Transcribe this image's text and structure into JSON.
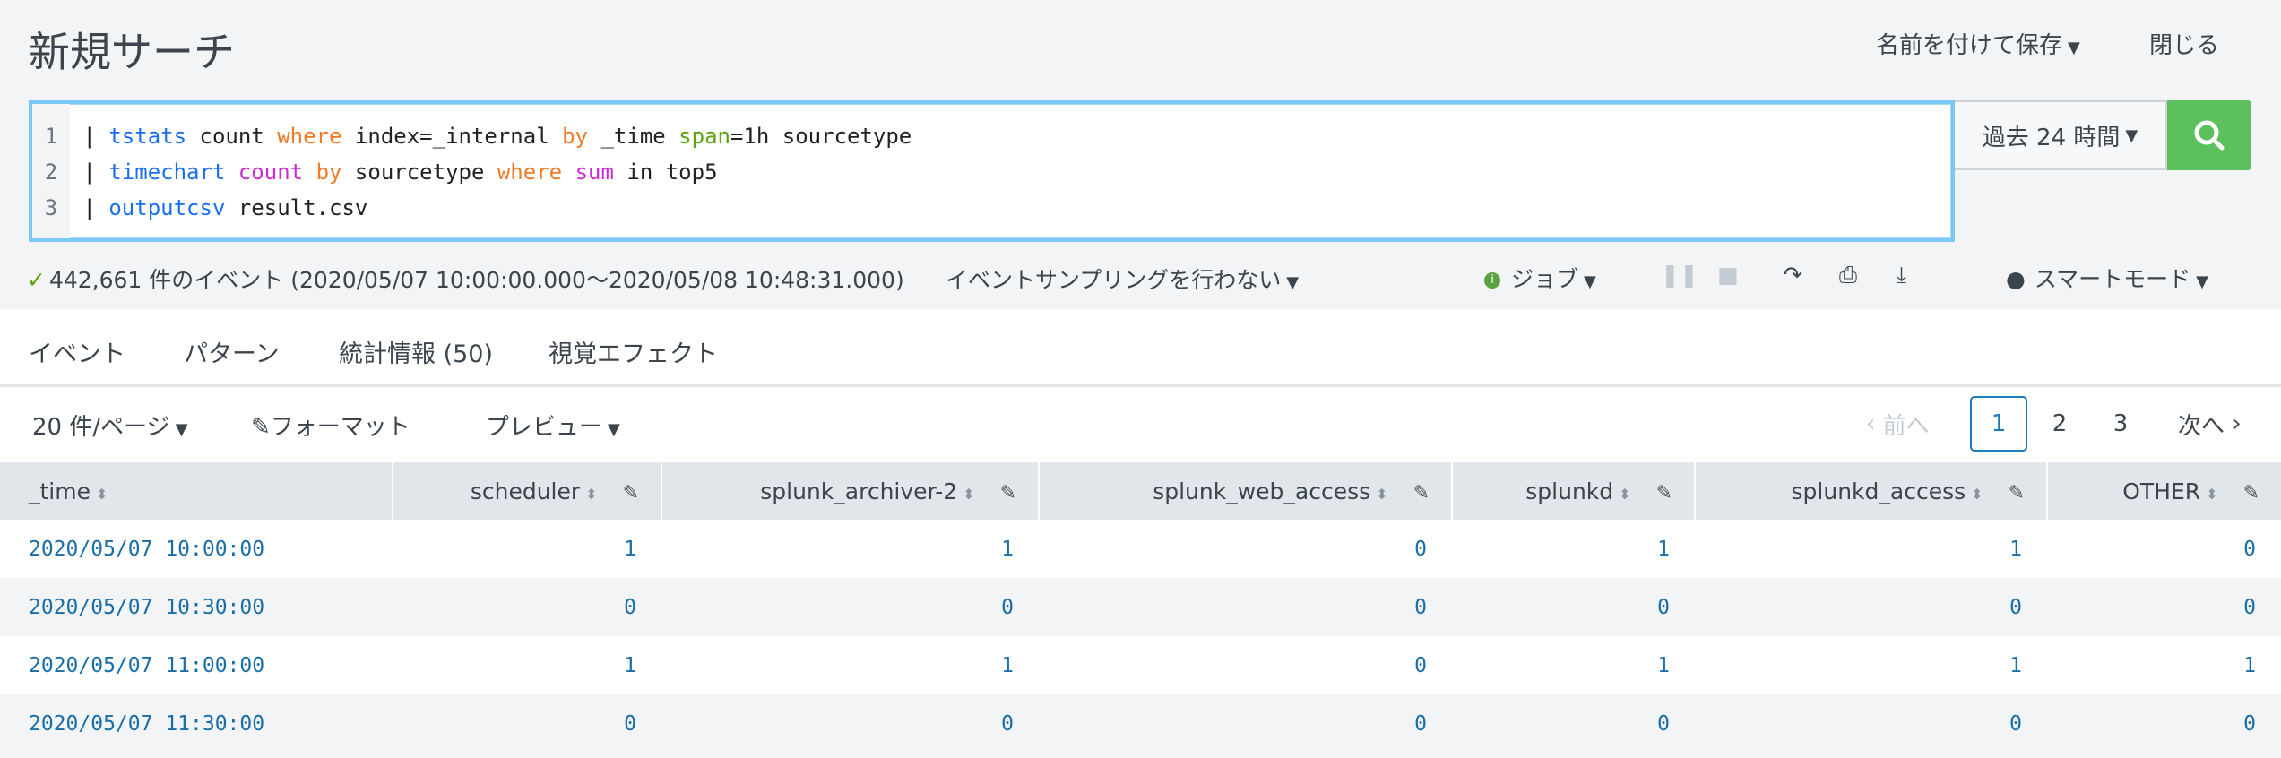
{
  "header": {
    "title": "新規サーチ",
    "save_as": "名前を付けて保存",
    "close": "閉じる"
  },
  "search": {
    "lines": [
      {
        "n": "1",
        "tokens": [
          [
            "| ",
            ""
          ],
          [
            "tstats",
            "kw"
          ],
          [
            " count ",
            ""
          ],
          [
            "where",
            "or"
          ],
          [
            " index=_internal ",
            ""
          ],
          [
            "by",
            "or"
          ],
          [
            " _time ",
            ""
          ],
          [
            "span",
            "gr"
          ],
          [
            "=1h sourcetype",
            ""
          ]
        ]
      },
      {
        "n": "2",
        "tokens": [
          [
            "| ",
            ""
          ],
          [
            "timechart",
            "kw"
          ],
          [
            " ",
            ""
          ],
          [
            "count",
            "mg"
          ],
          [
            " ",
            ""
          ],
          [
            "by",
            "or"
          ],
          [
            " sourcetype ",
            ""
          ],
          [
            "where",
            "or"
          ],
          [
            " ",
            ""
          ],
          [
            "sum",
            "mg"
          ],
          [
            " in top5",
            ""
          ]
        ]
      },
      {
        "n": "3",
        "tokens": [
          [
            "| ",
            ""
          ],
          [
            "outputcsv",
            "kw"
          ],
          [
            " result.csv",
            ""
          ]
        ]
      }
    ],
    "time_range": "過去 24 時間"
  },
  "status": {
    "events": "442,661 件のイベント (2020/05/07 10:00:00.000〜2020/05/08 10:48:31.000)",
    "sampling": "イベントサンプリングを行わない",
    "job": "ジョブ",
    "mode": "スマートモード"
  },
  "tabs": [
    {
      "label": "イベント"
    },
    {
      "label": "パターン"
    },
    {
      "label": "統計情報 (50)"
    },
    {
      "label": "視覚エフェクト"
    }
  ],
  "toolbar": {
    "per_page": "20 件/ページ",
    "format": "フォーマット",
    "preview": "プレビュー",
    "prev": "前へ",
    "next": "次へ",
    "pages": [
      "1",
      "2",
      "3"
    ]
  },
  "table": {
    "columns": [
      "_time",
      "scheduler",
      "splunk_archiver-2",
      "splunk_web_access",
      "splunkd",
      "splunkd_access",
      "OTHER"
    ],
    "rows": [
      [
        "2020/05/07 10:00:00",
        "1",
        "1",
        "0",
        "1",
        "1",
        "0"
      ],
      [
        "2020/05/07 10:30:00",
        "0",
        "0",
        "0",
        "0",
        "0",
        "0"
      ],
      [
        "2020/05/07 11:00:00",
        "1",
        "1",
        "0",
        "1",
        "1",
        "1"
      ],
      [
        "2020/05/07 11:30:00",
        "0",
        "0",
        "0",
        "0",
        "0",
        "0"
      ]
    ]
  }
}
